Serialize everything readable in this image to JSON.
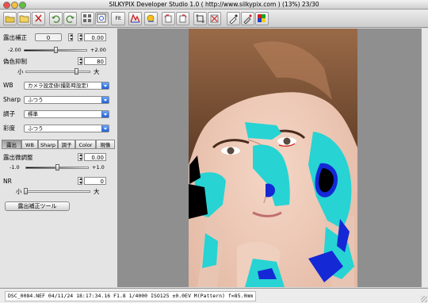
{
  "window": {
    "title": "SILKYPIX Developer Studio 1.0  ( http://www.silkypix.com ) (13%)  23/30"
  },
  "toolbar": {
    "fit_label": "Fit",
    "icons": [
      "open-folder-icon",
      "folder-icon",
      "cut-icon",
      "undo-icon",
      "redo-icon",
      "grid-view-icon",
      "single-view-icon",
      "fit-label",
      "color-filter-icon",
      "exposure-icon",
      "rotate-left-icon",
      "rotate-right-icon",
      "crop-icon",
      "delete-icon",
      "eyedropper-icon",
      "grey-picker-icon",
      "color-tool-icon"
    ]
  },
  "panel": {
    "exposure": {
      "label": "露出補正",
      "preset": "0",
      "value": "0.00",
      "min": "-2.00",
      "max": "+2.00",
      "level": 0.5
    },
    "false_color": {
      "label": "偽色抑制",
      "value": "80",
      "small": "小",
      "large": "大",
      "level": 0.8
    },
    "wb": {
      "label": "WB",
      "value": "カメラ設定値(撮影時設定)"
    },
    "sharp": {
      "label": "Sharp",
      "value": "ふつう"
    },
    "tone": {
      "label": "調子",
      "value": "標準"
    },
    "saturation": {
      "label": "彩度",
      "value": "ふつう"
    },
    "tabs": [
      "露出",
      "WB",
      "Sharp",
      "調子",
      "Color",
      "現像"
    ],
    "fine_exposure": {
      "label": "露出微調整",
      "value": "0.00",
      "min": "-1.0",
      "max": "+1.0",
      "level": 0.5
    },
    "nr": {
      "label": "NR",
      "value": "0",
      "small": "小",
      "large": "大",
      "level": 0.0
    },
    "tool_button": "露出補正ツール"
  },
  "status": {
    "text": "DSC_0084.NEF 04/11/24 18:17:34.16 F1.8 1/4000 ISO125 ±0.0EV M(Pattern) f=85.0mm"
  },
  "colors": {
    "highlight_warning": "#27d3d3",
    "shadow_warning": "#1428d6",
    "viewer_bg": "#8f8f8f"
  }
}
